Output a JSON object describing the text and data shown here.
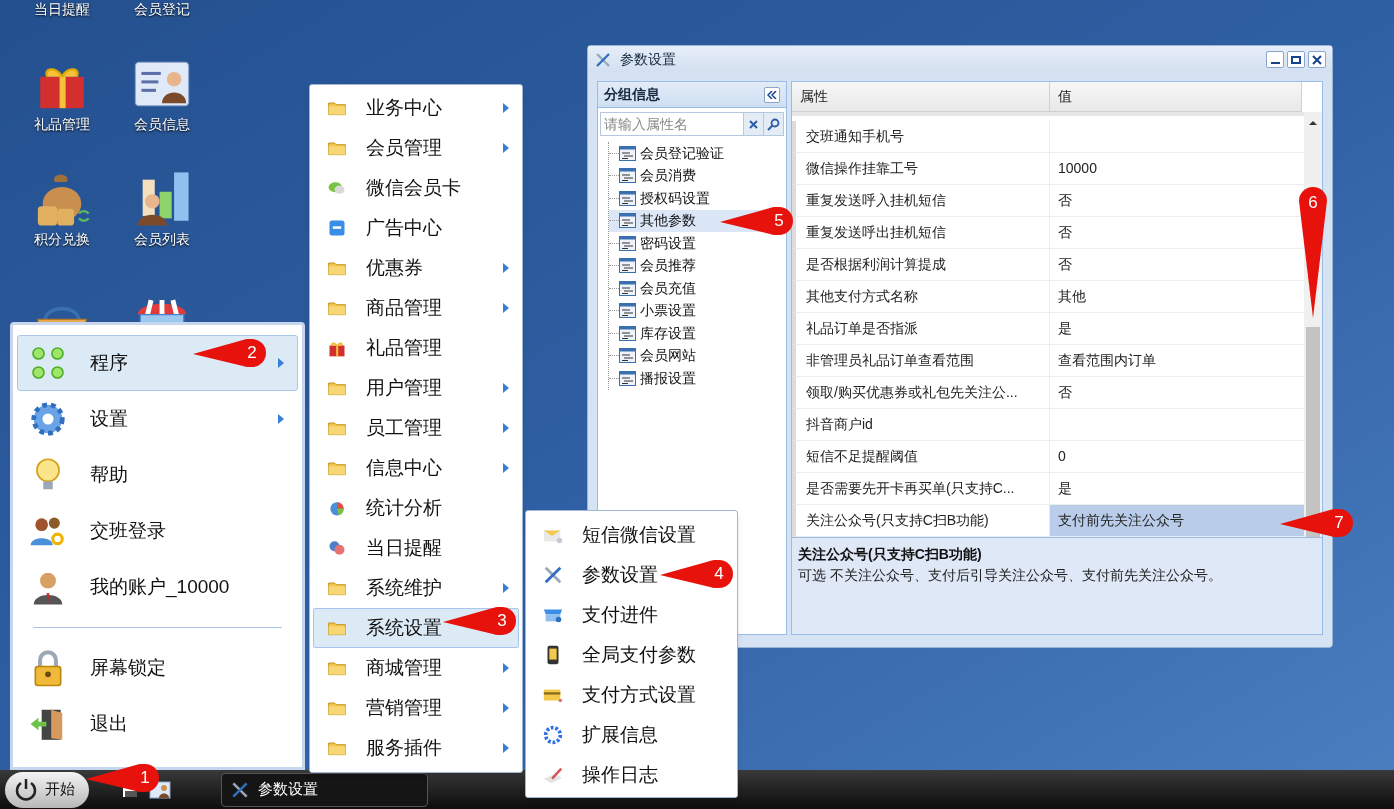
{
  "desktop_icons": [
    {
      "label": "当日提醒"
    },
    {
      "label": "会员登记"
    },
    {
      "label": "礼品管理",
      "kind": "gift"
    },
    {
      "label": "会员信息",
      "kind": "card"
    },
    {
      "label": "积分兑换",
      "kind": "moneybag"
    },
    {
      "label": "会员列表",
      "kind": "chart"
    },
    {
      "kind": "basket"
    },
    {
      "kind": "shop"
    }
  ],
  "start_menu": {
    "items": [
      {
        "kind": "dots",
        "label": "程序",
        "has_submenu": true,
        "selected": true
      },
      {
        "kind": "gear",
        "label": "设置",
        "has_submenu": true,
        "selected": false
      },
      {
        "kind": "bulb",
        "label": "帮助",
        "has_submenu": false,
        "selected": false
      },
      {
        "kind": "users",
        "label": "交班登录",
        "has_submenu": false,
        "selected": false
      },
      {
        "kind": "user",
        "label": "我的账户_10000",
        "has_submenu": false,
        "selected": false
      },
      {
        "kind": "separator"
      },
      {
        "kind": "lock",
        "label": "屏幕锁定",
        "has_submenu": false,
        "selected": false
      },
      {
        "kind": "door",
        "label": "退出",
        "has_submenu": false,
        "selected": false
      }
    ]
  },
  "programs_menu": {
    "items": [
      {
        "label": "业务中心",
        "kind": "folder",
        "has_submenu": true,
        "selected": false
      },
      {
        "label": "会员管理",
        "kind": "folder",
        "has_submenu": true,
        "selected": false
      },
      {
        "label": "微信会员卡",
        "kind": "wechat",
        "has_submenu": false,
        "selected": false
      },
      {
        "label": "广告中心",
        "kind": "ad",
        "has_submenu": false,
        "selected": false
      },
      {
        "label": "优惠券",
        "kind": "folder",
        "has_submenu": true,
        "selected": false
      },
      {
        "label": "商品管理",
        "kind": "folder",
        "has_submenu": true,
        "selected": false
      },
      {
        "label": "礼品管理",
        "kind": "gift",
        "has_submenu": false,
        "selected": false
      },
      {
        "label": "用户管理",
        "kind": "folder",
        "has_submenu": true,
        "selected": false
      },
      {
        "label": "员工管理",
        "kind": "folder",
        "has_submenu": true,
        "selected": false
      },
      {
        "label": "信息中心",
        "kind": "folder",
        "has_submenu": true,
        "selected": false
      },
      {
        "label": "统计分析",
        "kind": "pie",
        "has_submenu": false,
        "selected": false
      },
      {
        "label": "当日提醒",
        "kind": "bubble",
        "has_submenu": false,
        "selected": false
      },
      {
        "label": "系统维护",
        "kind": "folder",
        "has_submenu": true,
        "selected": false
      },
      {
        "label": "系统设置",
        "kind": "folder",
        "has_submenu": true,
        "selected": true
      },
      {
        "label": "商城管理",
        "kind": "folder",
        "has_submenu": true,
        "selected": false
      },
      {
        "label": "营销管理",
        "kind": "folder",
        "has_submenu": true,
        "selected": false
      },
      {
        "label": "服务插件",
        "kind": "folder",
        "has_submenu": true,
        "selected": false
      }
    ]
  },
  "settings_menu": {
    "items": [
      {
        "label": "短信微信设置",
        "kind": "mail"
      },
      {
        "label": "参数设置",
        "kind": "tools"
      },
      {
        "label": "支付进件",
        "kind": "store"
      },
      {
        "label": "全局支付参数",
        "kind": "phone"
      },
      {
        "label": "支付方式设置",
        "kind": "creditcard"
      },
      {
        "label": "扩展信息",
        "kind": "cog"
      },
      {
        "label": "操作日志",
        "kind": "pen"
      }
    ]
  },
  "window": {
    "title": "参数设置",
    "group_panel": {
      "title": "分组信息",
      "search": {
        "placeholder": "请输入属性名"
      },
      "tree": [
        {
          "label": "会员登记验证",
          "selected": false
        },
        {
          "label": "会员消费",
          "selected": false
        },
        {
          "label": "授权码设置",
          "selected": false
        },
        {
          "label": "其他参数",
          "selected": true
        },
        {
          "label": "密码设置",
          "selected": false
        },
        {
          "label": "会员推荐",
          "selected": false
        },
        {
          "label": "会员充值",
          "selected": false
        },
        {
          "label": "小票设置",
          "selected": false
        },
        {
          "label": "库存设置",
          "selected": false
        },
        {
          "label": "会员网站",
          "selected": false
        },
        {
          "label": "播报设置",
          "selected": false
        }
      ]
    },
    "property_grid": {
      "columns": [
        "属性",
        "值"
      ],
      "rows": [
        {
          "name": "交班通知手机号",
          "selected": false
        },
        {
          "name": "微信操作挂靠工号",
          "value": "10000",
          "selected": false
        },
        {
          "name": "重复发送呼入挂机短信",
          "value": "否",
          "selected": false
        },
        {
          "name": "重复发送呼出挂机短信",
          "value": "否",
          "selected": false
        },
        {
          "name": "是否根据利润计算提成",
          "value": "否",
          "selected": false
        },
        {
          "name": "其他支付方式名称",
          "value": "其他",
          "selected": false
        },
        {
          "name": "礼品订单是否指派",
          "value": "是",
          "selected": false
        },
        {
          "name": "非管理员礼品订单查看范围",
          "value": "查看范围内订单",
          "selected": false
        },
        {
          "name": "领取/购买优惠券或礼包先关注公...",
          "value": "否",
          "selected": false
        },
        {
          "name": "抖音商户id",
          "selected": false
        },
        {
          "name": "短信不足提醒阈值",
          "value": "0",
          "selected": false
        },
        {
          "name": "是否需要先开卡再买单(只支持C...",
          "value": "是",
          "selected": false
        },
        {
          "name": "关注公众号(只支持C扫B功能)",
          "value": "支付前先关注公众号",
          "selected": true
        }
      ],
      "description": {
        "title": "关注公众号(只支持C扫B功能)",
        "text": "可选 不关注公众号、支付后引导关注公众号、支付前先关注公众号。"
      }
    }
  },
  "taskbar": {
    "start_label": "开始",
    "tasks": [
      {
        "label": "参数设置"
      }
    ]
  },
  "callouts": [
    {
      "number": "1"
    },
    {
      "number": "2"
    },
    {
      "number": "3"
    },
    {
      "number": "4"
    },
    {
      "number": "5"
    },
    {
      "number": "6"
    },
    {
      "number": "7"
    }
  ]
}
